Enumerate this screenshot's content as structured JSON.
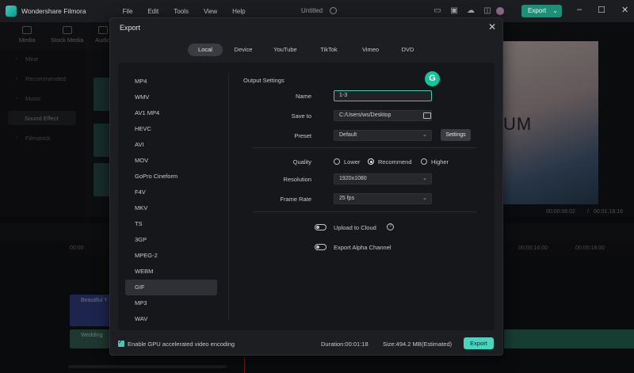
{
  "titlebar": {
    "app_name": "Wondershare Filmora",
    "menu": [
      "File",
      "Edit",
      "Tools",
      "View",
      "Help"
    ],
    "doc_title": "Untitled",
    "export_label": "Export"
  },
  "toptabs": [
    "Media",
    "Stock Media",
    "Audio"
  ],
  "sidebar": {
    "items": [
      "Mine",
      "Recommended",
      "Music",
      "Sound Effect",
      "Filmstock"
    ],
    "active": "Sound Effect"
  },
  "preview": {
    "overlay_text": "UM",
    "current_time": "00:00:06:02",
    "separator": "/",
    "total_time": "00:01:18:16"
  },
  "timeline": {
    "ruler": [
      "00:00",
      "00:00:16:00",
      "00:00:18:00"
    ],
    "clip_title": "Beautiful Y",
    "audio_title": "Wedding"
  },
  "dialog": {
    "title": "Export",
    "tabs": [
      "Local",
      "Device",
      "YouTube",
      "TikTok",
      "Vimeo",
      "DVD"
    ],
    "active_tab": "Local",
    "formats": [
      "MP4",
      "WMV",
      "AV1 MP4",
      "HEVC",
      "AVI",
      "MOV",
      "GoPro Cineform",
      "F4V",
      "MKV",
      "TS",
      "3GP",
      "MPEG-2",
      "WEBM",
      "GIF",
      "MP3",
      "WAV"
    ],
    "selected_format": "GIF",
    "output": {
      "section_title": "Output Settings",
      "name_label": "Name",
      "name_value": "1-3",
      "save_to_label": "Save to",
      "save_to_value": "C:/Users/ws/Desktop",
      "preset_label": "Preset",
      "preset_value": "Default",
      "settings_button": "Settings",
      "quality_label": "Quality",
      "quality_options": [
        "Lower",
        "Recommend",
        "Higher"
      ],
      "quality_selected": "Recommend",
      "resolution_label": "Resolution",
      "resolution_value": "1920x1080",
      "framerate_label": "Frame Rate",
      "framerate_value": "25 fps",
      "upload_cloud_label": "Upload to Cloud",
      "upload_cloud_on": false,
      "alpha_label": "Export Alpha Channel",
      "alpha_on": false
    },
    "footer": {
      "gpu_label": "Enable GPU accelerated video encoding",
      "gpu_checked": true,
      "duration": "Duration:00:01:18",
      "size": "Size:494.2 MB(Estimated)",
      "export_button": "Export"
    }
  },
  "colors": {
    "accent": "#4cd4be",
    "export_top": "#1f8e76",
    "grammarly": "#15c39a"
  }
}
